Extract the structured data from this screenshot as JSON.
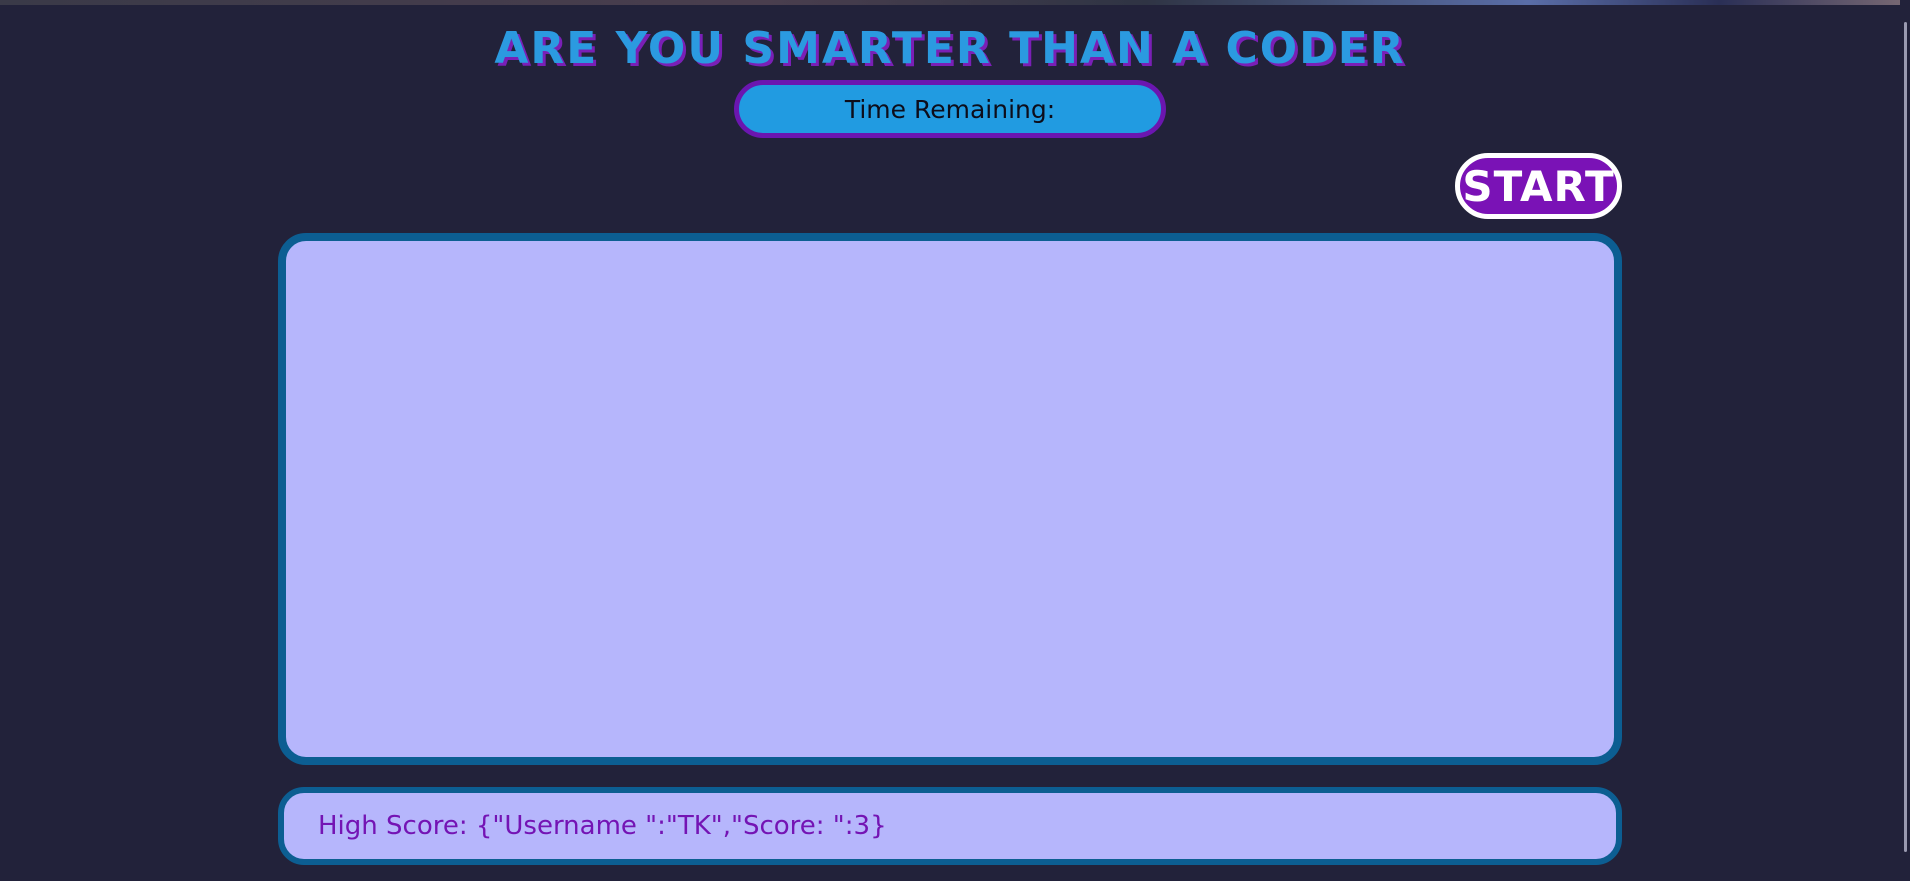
{
  "header": {
    "title": "ARE YOU SMARTER THAN A CODER",
    "timer_label": "Time Remaining:"
  },
  "controls": {
    "start_label": "START"
  },
  "quiz": {
    "content": ""
  },
  "footer": {
    "high_score_text": "High Score: {\"Username \":\"TK\",\"Score: \":3}"
  },
  "colors": {
    "background": "#22223a",
    "title": "#2b9ae0",
    "title_shadow": "#7a1fb6",
    "timer_fill": "#219be1",
    "accent_purple": "#7a12b6",
    "panel_fill": "#b6b6fc",
    "panel_border": "#0c5e92"
  }
}
